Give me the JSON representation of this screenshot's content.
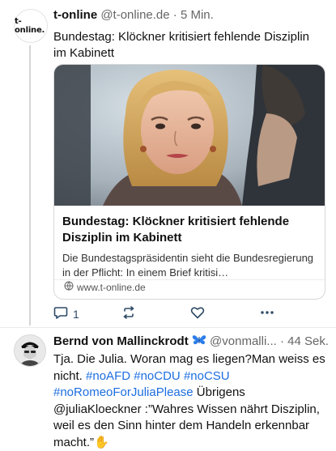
{
  "post1": {
    "avatar_text": "t-online.",
    "author": "t-online",
    "handle": "@t-online.de",
    "separator": "·",
    "time": "5 Min.",
    "text": "Bundestag: Klöckner kritisiert fehlende Disziplin im Kabinett",
    "card": {
      "title": "Bundestag: Klöckner kritisiert fehlende Disziplin im Kabinett",
      "description": "Die Bundestagspräsidentin sieht die Bundesregierung in der Pflicht: In einem Brief kritisi…",
      "domain": "www.t-online.de",
      "image_icon": "news-photo"
    },
    "actions": {
      "reply_count": "1",
      "reply_icon": "reply-icon",
      "repost_icon": "repost-icon",
      "like_icon": "heart-icon",
      "more_icon": "more-icon"
    }
  },
  "post2": {
    "author": "Bernd von Mallinckrodt",
    "author_emoji": "butterfly-icon",
    "handle": "@vonmalli...",
    "separator": "·",
    "time": "44 Sek.",
    "text_segments": [
      {
        "text": "Tja. Die Julia. Woran mag es liegen?Man weiss es nicht. ",
        "tag": false
      },
      {
        "text": "#noAFD",
        "tag": true
      },
      {
        "text": " ",
        "tag": false
      },
      {
        "text": "#noCDU",
        "tag": true
      },
      {
        "text": " ",
        "tag": false
      },
      {
        "text": "#noCSU",
        "tag": true
      },
      {
        "text": " ",
        "tag": false
      },
      {
        "text": "#noRomeoForJuliaPlease",
        "tag": true
      },
      {
        "text": " Übrigens @juliaKloeckner :”Wahres Wissen nährt Disziplin, weil es den Sinn hinter dem Handeln erkennbar macht.”",
        "tag": false
      },
      {
        "text": "✋",
        "tag": false
      }
    ]
  },
  "colors": {
    "accent": "#1d6ee0",
    "action": "#2e4a66",
    "muted": "#666666",
    "butterfly": "#2b7de9"
  }
}
